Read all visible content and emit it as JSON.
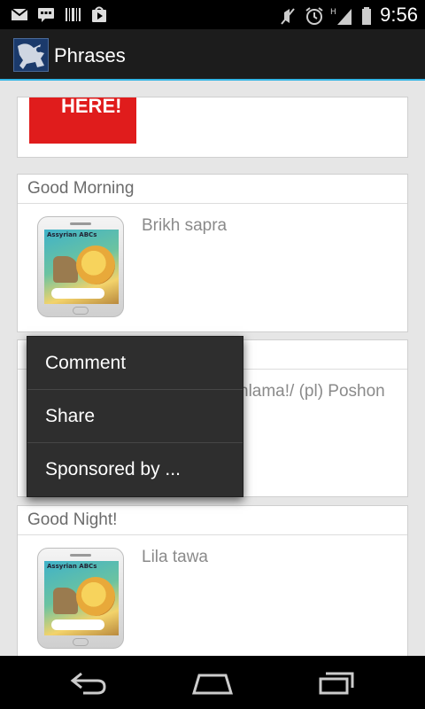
{
  "status_bar": {
    "time": "9:56",
    "left_icons": [
      "gmail-icon",
      "talk-icon",
      "barcode-icon",
      "play-store-icon"
    ],
    "right_icons": [
      "mute-icon",
      "alarm-icon",
      "signal-icon",
      "battery-icon"
    ],
    "network_label": "H"
  },
  "action_bar": {
    "title": "Phrases",
    "logo": "lamassu-logo-icon"
  },
  "cards": [
    {
      "header": "",
      "ad_text": "HERE!"
    },
    {
      "header": "Good Morning",
      "phrase": "Brikh sapra",
      "phone_screen_title": "Assyrian ABCs"
    },
    {
      "header": "",
      "phrase": "hlama!/ (pl) Poshon"
    },
    {
      "header": "Good Night!",
      "phrase": "Lila tawa",
      "phone_screen_title": "Assyrian ABCs"
    }
  ],
  "menu": {
    "items": [
      {
        "label": "Comment"
      },
      {
        "label": "Share"
      },
      {
        "label": "Sponsored by ..."
      }
    ]
  },
  "nav_bar": {
    "buttons": [
      "back-icon",
      "home-icon",
      "recent-apps-icon"
    ]
  },
  "colors": {
    "accent": "#33b5e5",
    "ad_red": "#e01c1c",
    "menu_bg": "#2e2e2e",
    "content_bg": "#e6e6e6"
  }
}
